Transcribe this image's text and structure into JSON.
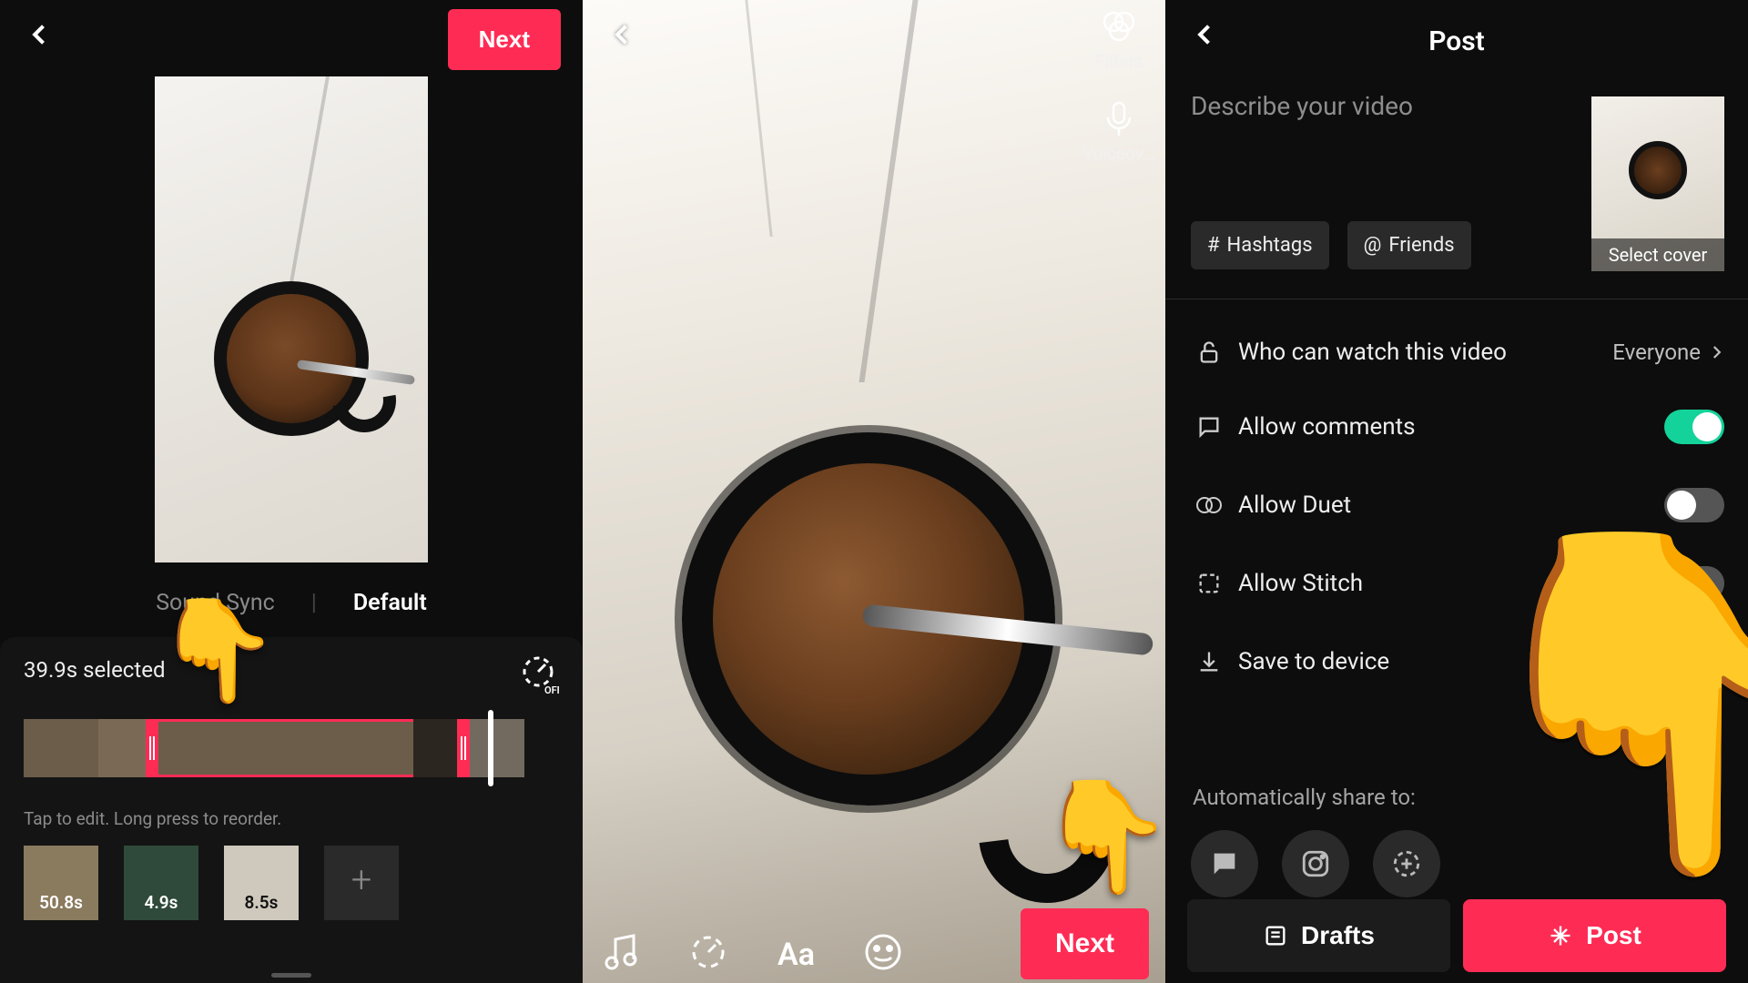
{
  "panel1": {
    "next_label": "Next",
    "tabs": {
      "sound_sync": "Sound Sync",
      "default": "Default"
    },
    "selected_label": "39.9s selected",
    "speed_off": "OFF",
    "hint": "Tap to edit. Long press to reorder.",
    "clips": [
      "50.8s",
      "4.9s",
      "8.5s"
    ]
  },
  "panel2": {
    "side": {
      "filters": "Filters",
      "voiceover": "Voiceov..."
    },
    "bottom": {
      "sounds": "",
      "effects": "",
      "text": "",
      "stickers": ""
    },
    "next_label": "Next"
  },
  "panel3": {
    "title": "Post",
    "placeholder": "Describe your video",
    "chip_hashtags": "Hashtags",
    "chip_friends": "Friends",
    "cover_label": "Select cover",
    "rows": {
      "privacy_label": "Who can watch this video",
      "privacy_value": "Everyone",
      "comments": "Allow comments",
      "duet": "Allow Duet",
      "stitch": "Allow Stitch",
      "save": "Save to device"
    },
    "auto_share": "Automatically share to:",
    "drafts": "Drafts",
    "post": "Post"
  }
}
